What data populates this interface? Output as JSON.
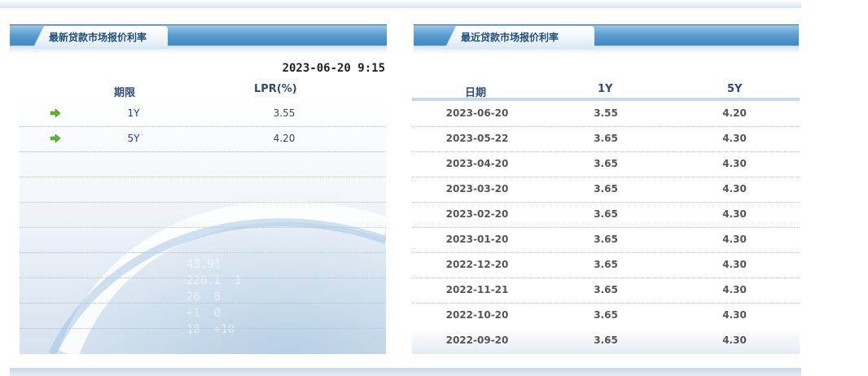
{
  "latest_panel": {
    "title": "最新贷款市场报价利率",
    "datetime": "2023-06-20 9:15",
    "columns": [
      "期限",
      "LPR(%)"
    ],
    "rows": [
      {
        "term": "1Y",
        "rate": "3.55"
      },
      {
        "term": "5Y",
        "rate": "4.20"
      }
    ]
  },
  "recent_panel": {
    "title": "最近贷款市场报价利率",
    "columns": [
      "日期",
      "1Y",
      "5Y"
    ],
    "rows": [
      {
        "date": "2023-06-20",
        "y1": "3.55",
        "y5": "4.20"
      },
      {
        "date": "2023-05-22",
        "y1": "3.65",
        "y5": "4.30"
      },
      {
        "date": "2023-04-20",
        "y1": "3.65",
        "y5": "4.30"
      },
      {
        "date": "2023-03-20",
        "y1": "3.65",
        "y5": "4.30"
      },
      {
        "date": "2023-02-20",
        "y1": "3.65",
        "y5": "4.30"
      },
      {
        "date": "2023-01-20",
        "y1": "3.65",
        "y5": "4.30"
      },
      {
        "date": "2022-12-20",
        "y1": "3.65",
        "y5": "4.30"
      },
      {
        "date": "2022-11-21",
        "y1": "3.65",
        "y5": "4.30"
      },
      {
        "date": "2022-10-20",
        "y1": "3.65",
        "y5": "4.30"
      },
      {
        "date": "2022-09-20",
        "y1": "3.65",
        "y5": "4.30"
      }
    ]
  },
  "colors": {
    "header_blue": "#3f86c1",
    "title_text": "#1f4e7a",
    "term_link": "#1a3fa6",
    "arrow_green": "#58b82a"
  },
  "icons": {
    "row_bullet": "green-arrow-icon"
  }
}
